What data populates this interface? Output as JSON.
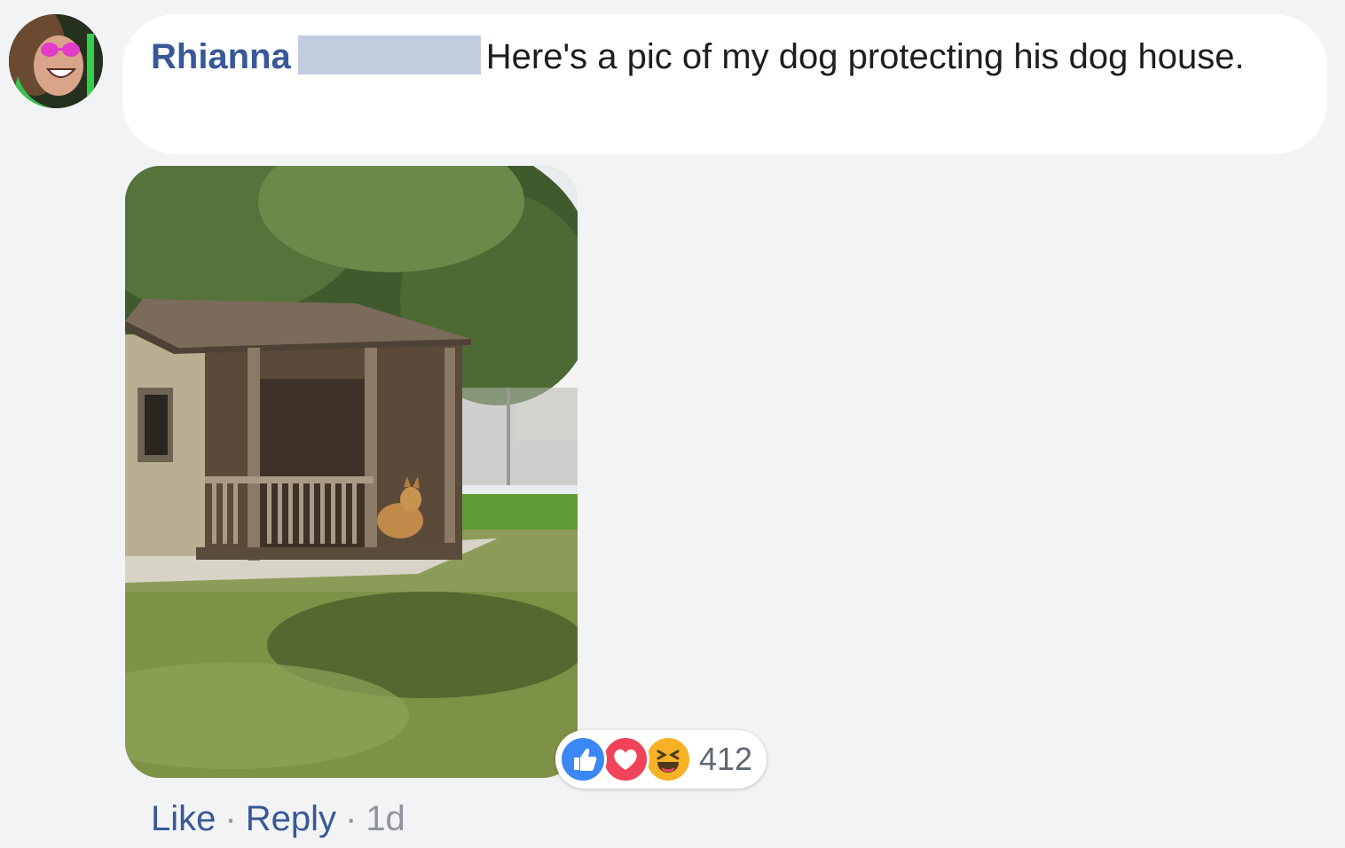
{
  "comment": {
    "author": "Rhianna",
    "text": "Here's a pic of my dog protecting his dog house."
  },
  "reactions": {
    "icons": [
      "like-icon",
      "love-icon",
      "haha-icon"
    ],
    "count": "412"
  },
  "actions": {
    "like_label": "Like",
    "reply_label": "Reply",
    "timestamp": "1d",
    "separator": "·"
  },
  "colors": {
    "link": "#385898",
    "like": "#3b88f5",
    "love": "#f0435a",
    "haha": "#f7b125"
  }
}
